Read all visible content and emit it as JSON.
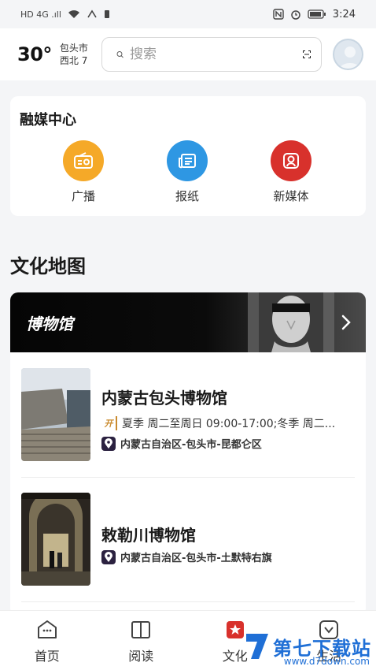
{
  "status_bar": {
    "left": "HD 4G .ıll",
    "time": "3:24"
  },
  "header": {
    "temperature": "30°",
    "city": "包头市",
    "wind": "西北 7",
    "search_placeholder": "搜索"
  },
  "media_center": {
    "title": "融媒中心",
    "items": [
      {
        "label": "广播",
        "icon": "radio-icon",
        "color": "#f5a928"
      },
      {
        "label": "报纸",
        "icon": "newspaper-icon",
        "color": "#2e97e3"
      },
      {
        "label": "新媒体",
        "icon": "new-media-icon",
        "color": "#d8312c"
      }
    ]
  },
  "culture_map": {
    "title": "文化地图",
    "banner_label": "博物馆",
    "museums": [
      {
        "name": "内蒙古包头博物馆",
        "hours": "夏季 周二至周日 09:00-17:00;冬季 周二...",
        "location": "内蒙古自治区-包头市-昆都仑区"
      },
      {
        "name": "敕勒川博物馆",
        "hours": "",
        "location": "内蒙古自治区-包头市-土默特右旗"
      }
    ]
  },
  "tabbar": {
    "items": [
      {
        "label": "首页",
        "icon": "home-icon"
      },
      {
        "label": "阅读",
        "icon": "book-icon"
      },
      {
        "label": "文化",
        "icon": "culture-icon"
      },
      {
        "label": "生活",
        "icon": "life-icon"
      }
    ]
  },
  "watermark": {
    "text": "第七下载站",
    "url": "www.d7down.com"
  }
}
